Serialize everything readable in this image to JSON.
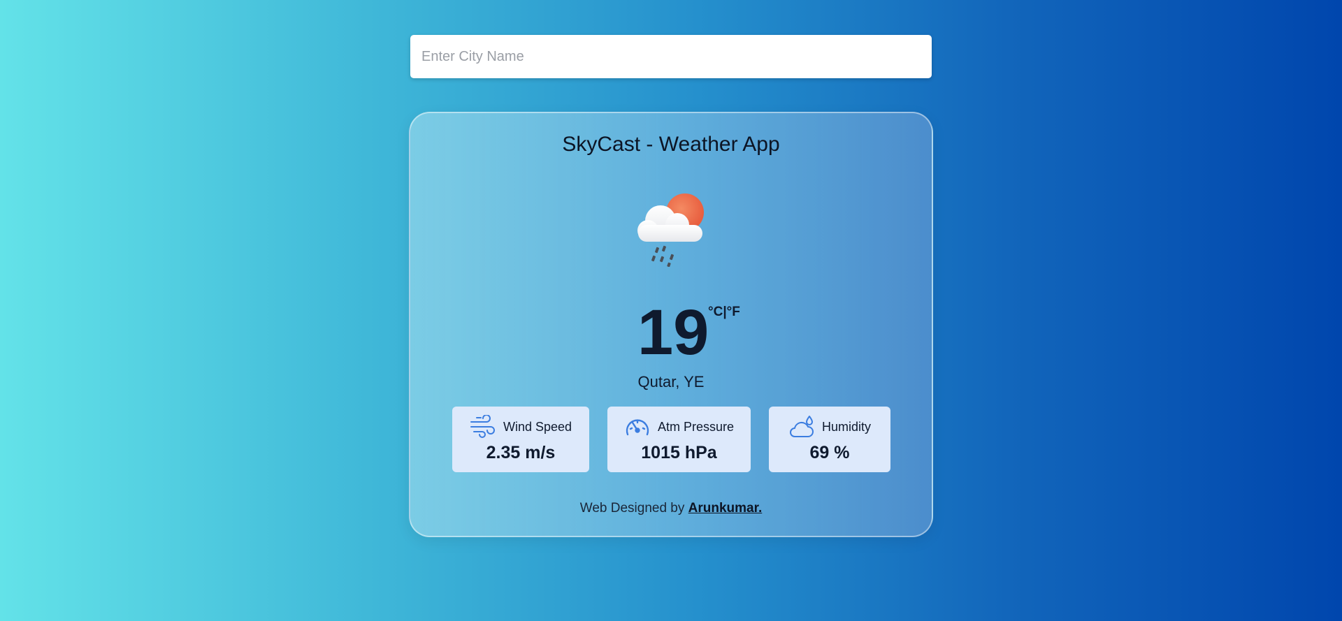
{
  "search": {
    "placeholder": "Enter City Name",
    "value": ""
  },
  "card": {
    "title": "SkyCast - Weather App",
    "weather_icon": "cloud-sun-rain-icon",
    "temperature": "19",
    "unit_toggle": "°C|°F",
    "location": "Qutar, YE"
  },
  "stats": {
    "wind": {
      "label": "Wind Speed",
      "value": "2.35 m/s",
      "icon": "wind-icon"
    },
    "pressure": {
      "label": "Atm Pressure",
      "value": "1015 hPa",
      "icon": "gauge-icon"
    },
    "humidity": {
      "label": "Humidity",
      "value": "69 %",
      "icon": "cloud-drop-icon"
    }
  },
  "footer": {
    "prefix": "Web Designed by",
    "author": "Arunkumar."
  },
  "colors": {
    "gradient_start": "#63e2e8",
    "gradient_end": "#0046ad",
    "stat_box_bg": "#dde9fb",
    "icon_accent": "#3b7de0",
    "sun": "#ee6c4d"
  }
}
